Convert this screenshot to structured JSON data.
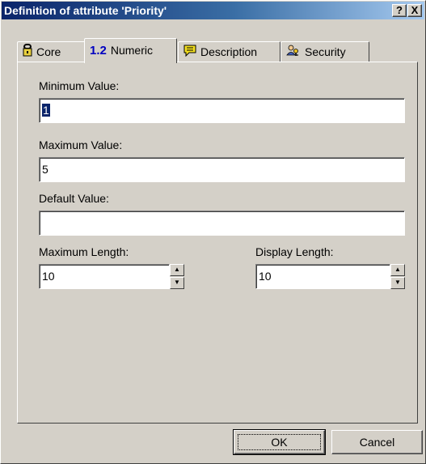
{
  "window": {
    "title": "Definition of attribute 'Priority'",
    "help_label": "?",
    "close_label": "X"
  },
  "tabs": [
    {
      "label": "Core",
      "icon": "lock-icon"
    },
    {
      "label": "Numeric",
      "icon_text": "1.2",
      "active": true
    },
    {
      "label": "Description",
      "icon": "note-icon"
    },
    {
      "label": "Security",
      "icon": "users-key-icon"
    }
  ],
  "form": {
    "min_label": "Minimum Value:",
    "min_value": "1",
    "max_label": "Maximum Value:",
    "max_value": "5",
    "default_label": "Default Value:",
    "default_value": "",
    "maxlen_label": "Maximum Length:",
    "maxlen_value": "10",
    "displen_label": "Display Length:",
    "displen_value": "10"
  },
  "buttons": {
    "ok": "OK",
    "cancel": "Cancel"
  },
  "colors": {
    "title_bar": "#0a246a",
    "face": "#d4d0c8",
    "tab_numeric_icon": "#0000c0"
  }
}
